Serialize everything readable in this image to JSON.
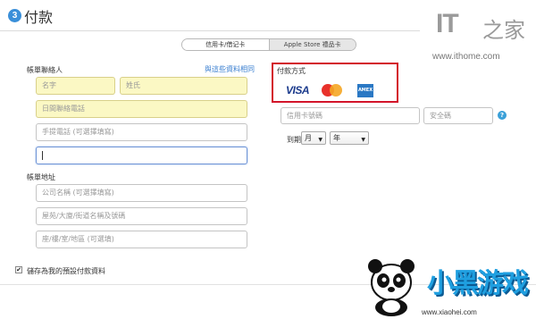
{
  "header": {
    "step_number": "3",
    "title": "付款"
  },
  "watermark_top": {
    "logo_it": "IT",
    "logo_zh": "之家",
    "url": "www.ithome.com"
  },
  "payment_tabs": [
    {
      "label": "信用卡/借记卡",
      "active": true
    },
    {
      "label": "Apple Store 禮品卡",
      "active": false
    }
  ],
  "contact": {
    "section_label": "帳單聯絡人",
    "link_label": "與這些資料相同",
    "first_name_placeholder": "名字",
    "last_name_placeholder": "姓氏",
    "day_phone_placeholder": "日間聯絡電話",
    "mobile_placeholder": "手提電話 (可選擇填寫)",
    "email_value": ""
  },
  "address": {
    "section_label": "帳單地址",
    "company_placeholder": "公司名稱 (可選擇填寫)",
    "street_placeholder": "屋苑/大廈/街道名稱及號碼",
    "floor_placeholder": "座/樓/室/地區 (可選填)"
  },
  "payment": {
    "section_label": "付款方式",
    "cards": [
      {
        "name": "VISA",
        "icon": "visa-icon"
      },
      {
        "name": "MasterCard",
        "icon": "mastercard-icon"
      },
      {
        "name": "AMEX",
        "icon": "amex-icon"
      }
    ],
    "card_number_placeholder": "信用卡號碼",
    "security_code_placeholder": "安全碼",
    "help_icon": "?",
    "expiry_label": "到期",
    "month_selected": "月",
    "year_selected": "年"
  },
  "save_default": {
    "checked": true,
    "label": "儲存為我的預設付款資料"
  },
  "watermark_bottom": {
    "title": "小黑游戏",
    "url": "www.xiaohei.com"
  },
  "colors": {
    "accent_blue": "#3a8fd9",
    "highlight_red": "#d3142a",
    "autofill_yellow": "#fbf8c4"
  }
}
